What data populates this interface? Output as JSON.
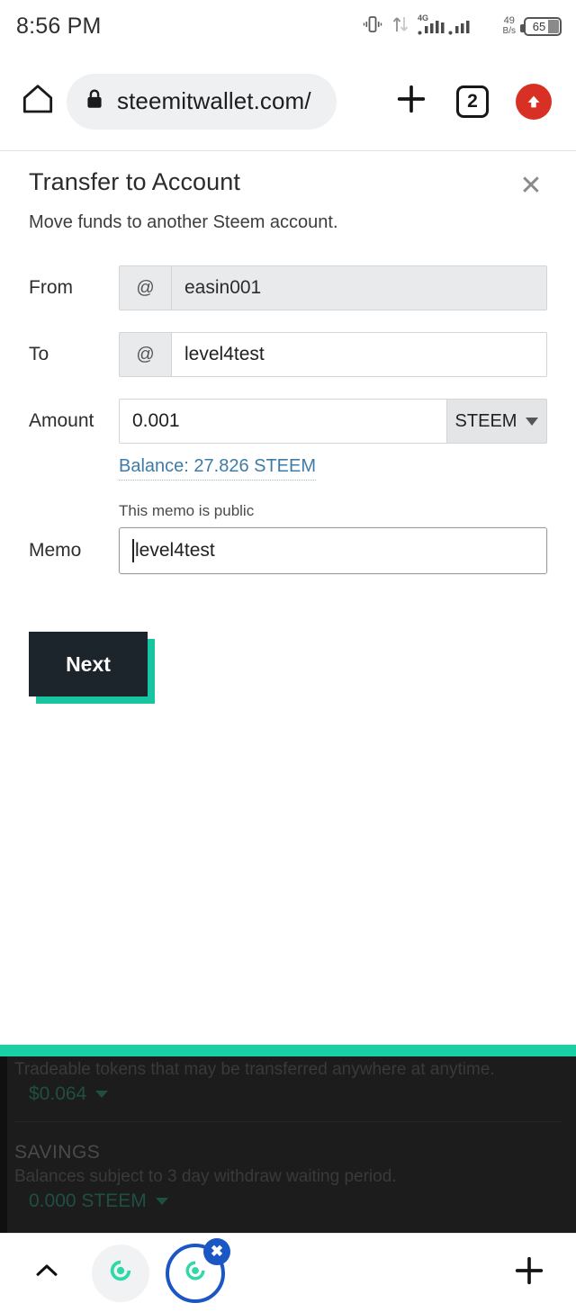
{
  "status_bar": {
    "time": "8:56 PM",
    "vibrate_icon": "vibrate-icon",
    "data_transfer_icon": "data-transfer-icon",
    "network_type": "4G",
    "signal_icon": "signal-bars-icon",
    "net_speed_value": "49",
    "net_speed_unit": "B/s",
    "battery_level": "65"
  },
  "browser": {
    "home_icon": "home-icon",
    "lock_icon": "lock-icon",
    "url": "steemitwallet.com/",
    "new_tab_icon": "plus-icon",
    "tab_count": "2",
    "update_icon": "upload-arrow-icon"
  },
  "panel": {
    "title": "Transfer to Account",
    "subtitle": "Move funds to another Steem account.",
    "close_icon": "close-icon"
  },
  "form": {
    "from": {
      "label": "From",
      "prefix": "@",
      "value": "easin001",
      "readonly": true
    },
    "to": {
      "label": "To",
      "prefix": "@",
      "value": "level4test",
      "placeholder": ""
    },
    "amount": {
      "label": "Amount",
      "value": "0.001",
      "placeholder": "",
      "unit": "STEEM",
      "caret_icon": "chevron-down-icon",
      "balance_link": "Balance: 27.826 STEEM"
    },
    "memo": {
      "label": "Memo",
      "hint": "This memo is public",
      "value": "level4test",
      "placeholder": ""
    },
    "submit_label": "Next"
  },
  "background_page": {
    "tradeable_note": "Tradeable tokens that may be transferred anywhere at anytime.",
    "tradeable_value": "$0.064",
    "savings_heading": "SAVINGS",
    "savings_note": "Balances subject to 3 day withdraw waiting period.",
    "savings_value": "0.000 STEEM",
    "caret_icon": "chevron-down-icon"
  },
  "bottom_nav": {
    "expand_icon": "chevron-up-icon",
    "tab_inactive_icon": "steem-favicon",
    "tab_active_icon": "steem-favicon",
    "tab_close_icon": "close-icon",
    "add_tab_icon": "plus-icon"
  },
  "colors": {
    "accent_teal": "#19cfa6",
    "button_dark": "#1d252c",
    "link_blue": "#3e7ca8",
    "browser_blue": "#1a56c4",
    "update_red": "#d93025"
  }
}
